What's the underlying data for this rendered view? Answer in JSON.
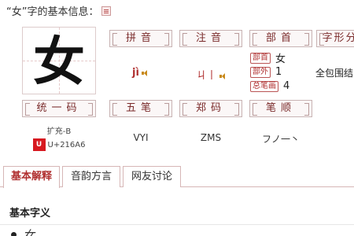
{
  "header": {
    "title": "“女”字的基本信息：",
    "pinyin_doc_icon": "document-icon"
  },
  "character": {
    "glyph": "女"
  },
  "labels": {
    "pinyin": "拼音",
    "zhuyin": "注音",
    "bushou": "部首",
    "structure": "字形分",
    "unicode": "统一码",
    "wubi": "五笔",
    "zhengma": "郑码",
    "bishun": "笔顺"
  },
  "values": {
    "pinyin": "jì",
    "zhuyin": "ㄐ丨",
    "bushou": [
      {
        "tag": "部首",
        "value": "女"
      },
      {
        "tag": "部外",
        "value": "1"
      },
      {
        "tag": "总笔画",
        "value": "4"
      }
    ],
    "structure": "全包围结",
    "unicode_block": "扩充-B",
    "unicode_code": "U+216A6",
    "unicode_logo": "UNICODE",
    "wubi": "VYI",
    "zhengma": "ZMS",
    "bishun": "フノ一丶"
  },
  "tabs": [
    {
      "label": "基本解释",
      "active": true
    },
    {
      "label": "音韵方言",
      "active": false
    },
    {
      "label": "网友讨论",
      "active": false
    }
  ],
  "content": {
    "section_title": "基本字义",
    "first_item": "女"
  },
  "colors": {
    "accent": "#b03030",
    "border": "#c8b3b3",
    "speaker": "#c8891a"
  }
}
